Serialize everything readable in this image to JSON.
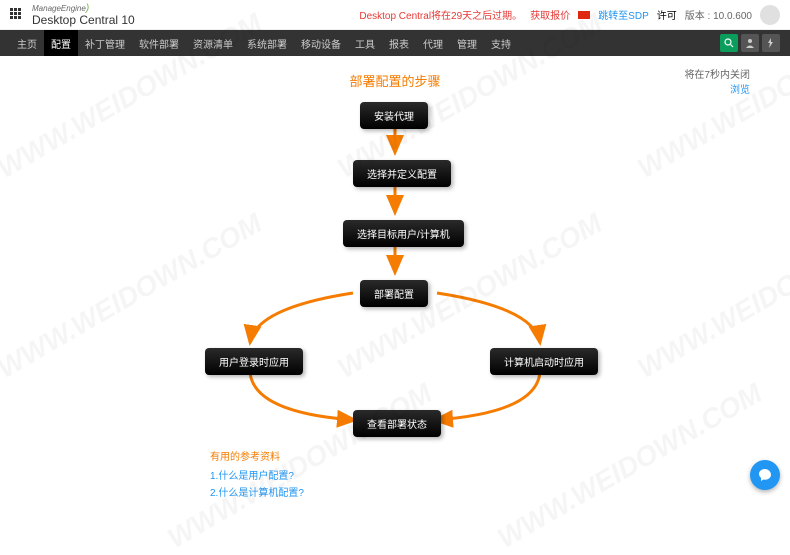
{
  "header": {
    "brand": "ManageEngine",
    "product": "Desktop Central 10",
    "expiry_text": "Desktop Central将在29天之后过期。",
    "quote": "获取报价",
    "sdp": "跳转至SDP",
    "license": "许可",
    "version": "版本 : 10.0.600"
  },
  "nav": {
    "items": [
      "主页",
      "配置",
      "补丁管理",
      "软件部署",
      "资源清单",
      "系统部署",
      "移动设备",
      "工具",
      "报表",
      "代理",
      "管理",
      "支持"
    ]
  },
  "flow": {
    "title": "部署配置的步骤",
    "close_text": "将在7秒内关闭",
    "browse": "浏览",
    "nodes": {
      "n1": "安装代理",
      "n2": "选择并定义配置",
      "n3": "选择目标用户/计算机",
      "n4": "部署配置",
      "n5": "用户登录时应用",
      "n6": "计算机启动时应用",
      "n7": "查看部署状态"
    }
  },
  "help": {
    "title": "有用的参考资料",
    "links": [
      "1.什么是用户配置?",
      "2.什么是计算机配置?"
    ]
  },
  "watermark": "WWW.WEIDOWN.COM"
}
